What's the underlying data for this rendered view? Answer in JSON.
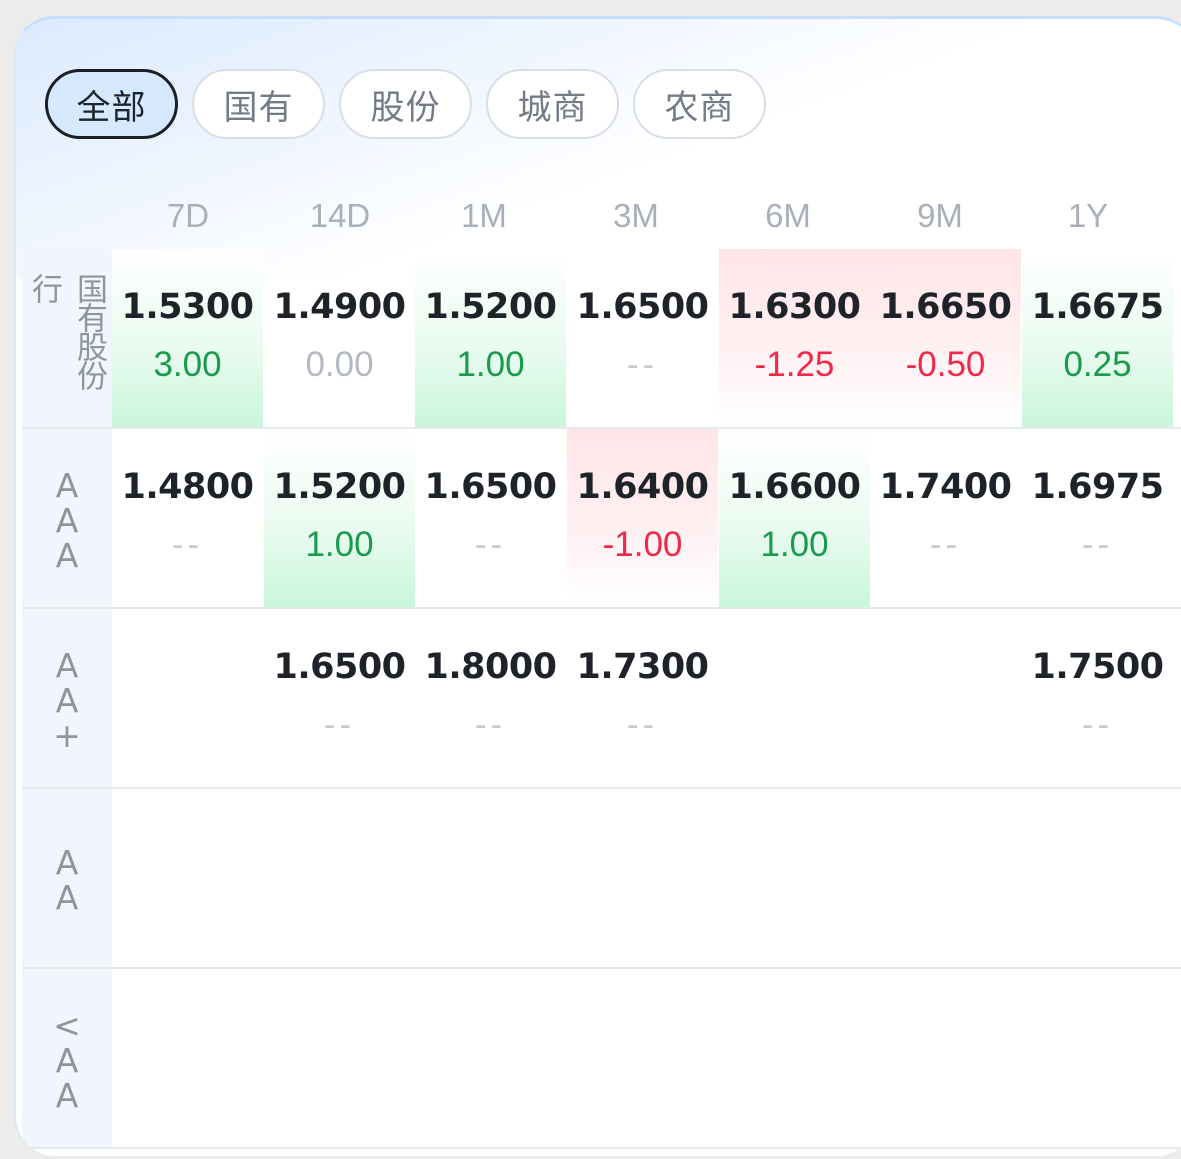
{
  "filters": [
    {
      "label": "全部",
      "active": true
    },
    {
      "label": "国有",
      "active": false
    },
    {
      "label": "股份",
      "active": false
    },
    {
      "label": "城商",
      "active": false
    },
    {
      "label": "农商",
      "active": false
    }
  ],
  "columns": [
    "7D",
    "14D",
    "1M",
    "3M",
    "6M",
    "9M",
    "1Y"
  ],
  "rows": [
    {
      "label": "国有股份行",
      "cells": [
        {
          "value": "1.5300",
          "change": "3.00",
          "trend": "up"
        },
        {
          "value": "1.4900",
          "change": "0.00",
          "trend": "flat"
        },
        {
          "value": "1.5200",
          "change": "1.00",
          "trend": "up"
        },
        {
          "value": "1.6500",
          "change": "--",
          "trend": "none"
        },
        {
          "value": "1.6300",
          "change": "-1.25",
          "trend": "down"
        },
        {
          "value": "1.6650",
          "change": "-0.50",
          "trend": "down"
        },
        {
          "value": "1.6675",
          "change": "0.25",
          "trend": "up"
        }
      ]
    },
    {
      "label": "AAA",
      "cells": [
        {
          "value": "1.4800",
          "change": "--",
          "trend": "none"
        },
        {
          "value": "1.5200",
          "change": "1.00",
          "trend": "up"
        },
        {
          "value": "1.6500",
          "change": "--",
          "trend": "none"
        },
        {
          "value": "1.6400",
          "change": "-1.00",
          "trend": "down"
        },
        {
          "value": "1.6600",
          "change": "1.00",
          "trend": "up"
        },
        {
          "value": "1.7400",
          "change": "--",
          "trend": "none"
        },
        {
          "value": "1.6975",
          "change": "--",
          "trend": "none"
        }
      ]
    },
    {
      "label": "AA+",
      "cells": [
        {
          "value": "",
          "change": "",
          "trend": "empty"
        },
        {
          "value": "1.6500",
          "change": "--",
          "trend": "none"
        },
        {
          "value": "1.8000",
          "change": "--",
          "trend": "none"
        },
        {
          "value": "1.7300",
          "change": "--",
          "trend": "none"
        },
        {
          "value": "",
          "change": "",
          "trend": "empty"
        },
        {
          "value": "",
          "change": "",
          "trend": "empty"
        },
        {
          "value": "1.7500",
          "change": "--",
          "trend": "none"
        }
      ]
    },
    {
      "label": "AA",
      "cells": [
        {
          "value": "",
          "change": "",
          "trend": "empty"
        },
        {
          "value": "",
          "change": "",
          "trend": "empty"
        },
        {
          "value": "",
          "change": "",
          "trend": "empty"
        },
        {
          "value": "",
          "change": "",
          "trend": "empty"
        },
        {
          "value": "",
          "change": "",
          "trend": "empty"
        },
        {
          "value": "",
          "change": "",
          "trend": "empty"
        },
        {
          "value": "",
          "change": "",
          "trend": "empty"
        }
      ]
    },
    {
      "label": "<AA",
      "cells": [
        {
          "value": "",
          "change": "",
          "trend": "empty"
        },
        {
          "value": "",
          "change": "",
          "trend": "empty"
        },
        {
          "value": "",
          "change": "",
          "trend": "empty"
        },
        {
          "value": "",
          "change": "",
          "trend": "empty"
        },
        {
          "value": "",
          "change": "",
          "trend": "empty"
        },
        {
          "value": "",
          "change": "",
          "trend": "empty"
        },
        {
          "value": "",
          "change": "",
          "trend": "empty"
        }
      ]
    }
  ],
  "colors": {
    "up": "#1a9a4c",
    "down": "#f0294a",
    "accent": "#d6e9ff"
  }
}
